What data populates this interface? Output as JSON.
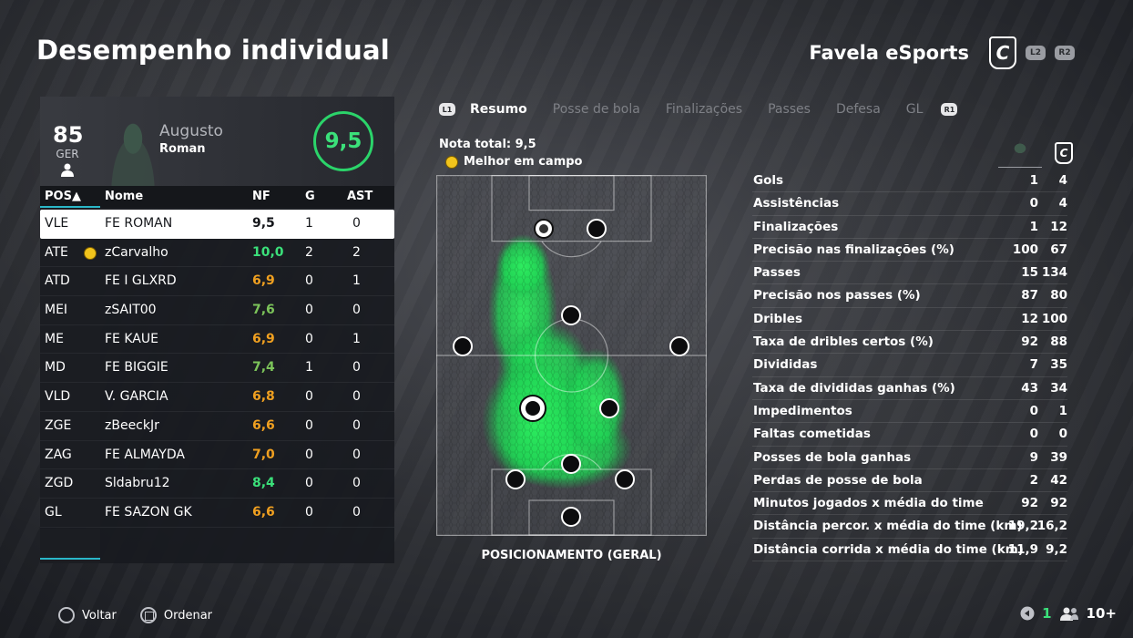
{
  "header": {
    "title": "Desempenho individual",
    "team_name": "Favela eSports",
    "team_logo_letter": "C",
    "prev_team_button": "L2",
    "next_team_button": "R2"
  },
  "player": {
    "rating": "85",
    "position": "GER",
    "first_name": "Augusto",
    "last_name": "Roman",
    "match_score": "9,5"
  },
  "table": {
    "headers": {
      "pos": "POS▲",
      "name": "Nome",
      "nf": "NF",
      "g": "G",
      "ast": "AST"
    },
    "rows": [
      {
        "pos": "VLE",
        "name": "FE ROMAN",
        "nf": "9,5",
        "g": "1",
        "ast": "0",
        "nf_color": "#15171b",
        "selected": true,
        "star": false
      },
      {
        "pos": "ATE",
        "name": "zCarvalho",
        "nf": "10,0",
        "g": "2",
        "ast": "2",
        "nf_color": "#3be07a",
        "selected": false,
        "star": true
      },
      {
        "pos": "ATD",
        "name": "FE I GLXRD",
        "nf": "6,9",
        "g": "0",
        "ast": "1",
        "nf_color": "#f0a020",
        "selected": false,
        "star": false
      },
      {
        "pos": "MEI",
        "name": "zSAIT00",
        "nf": "7,6",
        "g": "0",
        "ast": "0",
        "nf_color": "#7cc45a",
        "selected": false,
        "star": false
      },
      {
        "pos": "ME",
        "name": "FE KAUE",
        "nf": "6,9",
        "g": "0",
        "ast": "1",
        "nf_color": "#f0a020",
        "selected": false,
        "star": false
      },
      {
        "pos": "MD",
        "name": "FE BIGGIE",
        "nf": "7,4",
        "g": "1",
        "ast": "0",
        "nf_color": "#7cc45a",
        "selected": false,
        "star": false
      },
      {
        "pos": "VLD",
        "name": "V. GARCIA",
        "nf": "6,8",
        "g": "0",
        "ast": "0",
        "nf_color": "#f0a020",
        "selected": false,
        "star": false
      },
      {
        "pos": "ZGE",
        "name": "zBeeckJr",
        "nf": "6,6",
        "g": "0",
        "ast": "0",
        "nf_color": "#f0a020",
        "selected": false,
        "star": false
      },
      {
        "pos": "ZAG",
        "name": "FE ALMAYDA",
        "nf": "7,0",
        "g": "0",
        "ast": "0",
        "nf_color": "#f0a020",
        "selected": false,
        "star": false
      },
      {
        "pos": "ZGD",
        "name": "Sldabru12",
        "nf": "8,4",
        "g": "0",
        "ast": "0",
        "nf_color": "#3be07a",
        "selected": false,
        "star": false
      },
      {
        "pos": "GL",
        "name": "FE SAZON GK",
        "nf": "6,6",
        "g": "0",
        "ast": "0",
        "nf_color": "#f0a020",
        "selected": false,
        "star": false
      }
    ]
  },
  "tabs": {
    "left_button": "L1",
    "right_button": "R1",
    "items": [
      "Resumo",
      "Posse de bola",
      "Finalizações",
      "Passes",
      "Defesa",
      "GL"
    ],
    "active": "Resumo"
  },
  "summary": {
    "total_score": "Nota total: 9,5",
    "best_on_field": "Melhor em campo",
    "pitch_caption": "POSICIONAMENTO (GERAL)"
  },
  "stats": [
    {
      "label": "Gols",
      "player": "1",
      "team": "4"
    },
    {
      "label": "Assistências",
      "player": "0",
      "team": "4"
    },
    {
      "label": "Finalizações",
      "player": "1",
      "team": "12"
    },
    {
      "label": "Precisão nas finalizações (%)",
      "player": "100",
      "team": "67"
    },
    {
      "label": "Passes",
      "player": "15",
      "team": "134"
    },
    {
      "label": "Precisão nos passes (%)",
      "player": "87",
      "team": "80"
    },
    {
      "label": "Dribles",
      "player": "12",
      "team": "100"
    },
    {
      "label": "Taxa de dribles certos (%)",
      "player": "92",
      "team": "88"
    },
    {
      "label": "Divididas",
      "player": "7",
      "team": "35"
    },
    {
      "label": "Taxa de divididas ganhas (%)",
      "player": "43",
      "team": "34"
    },
    {
      "label": "Impedimentos",
      "player": "0",
      "team": "1"
    },
    {
      "label": "Faltas cometidas",
      "player": "0",
      "team": "0"
    },
    {
      "label": "Posses de bola ganhas",
      "player": "9",
      "team": "39"
    },
    {
      "label": "Perdas de posse de bola",
      "player": "2",
      "team": "42"
    },
    {
      "label": "Minutos jogados x média do time",
      "player": "92",
      "team": "92"
    },
    {
      "label": "Distância percor. x média do time (km)",
      "player": "19,2",
      "team": "16,2"
    },
    {
      "label": "Distância corrida x média do time (km)",
      "player": "11,9",
      "team": "9,2"
    }
  ],
  "footer": {
    "back": "Voltar",
    "sort": "Ordenar",
    "count": "1",
    "players": "10+"
  },
  "colors": {
    "accent_green": "#3be07a",
    "accent_cyan": "#2ab7c8",
    "rating_orange": "#f0a020"
  }
}
